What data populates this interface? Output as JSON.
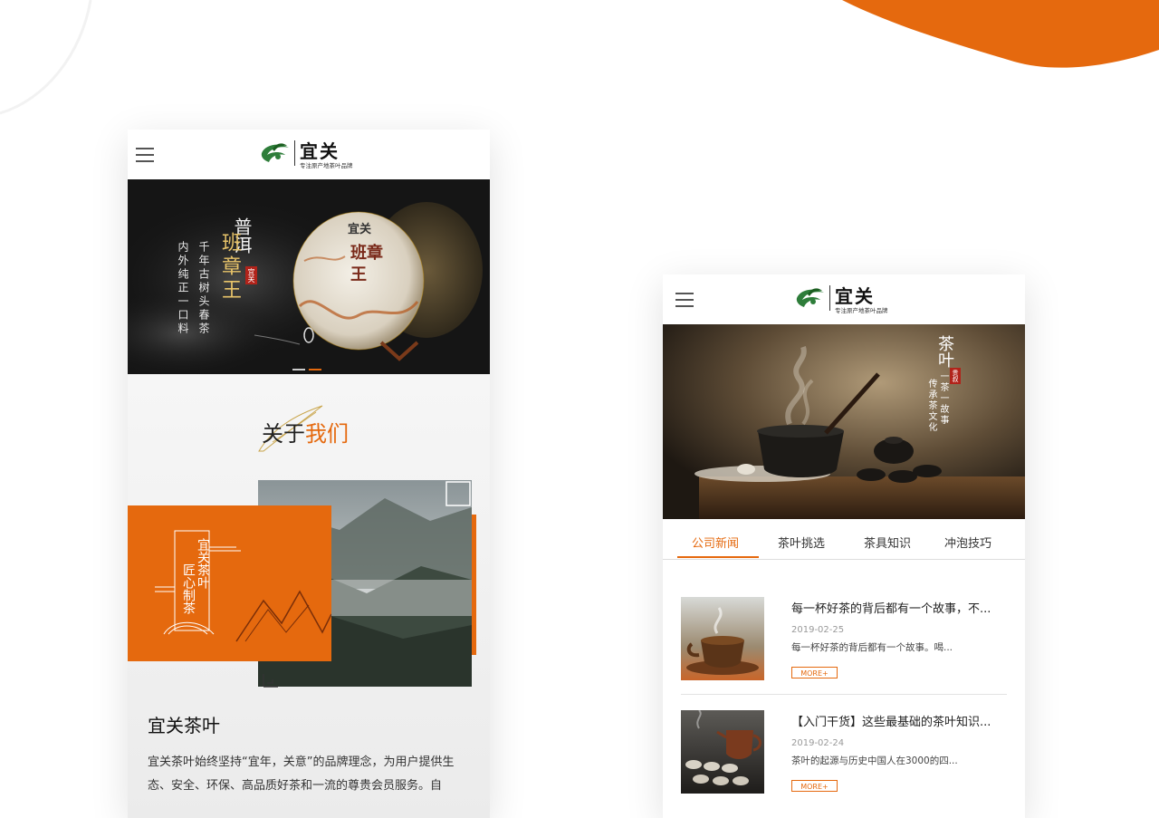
{
  "brand": {
    "name": "宜关",
    "tagline": "专注原产地茶叶品牌",
    "accent_color": "#e5690e"
  },
  "left_phone": {
    "banner": {
      "line_main_top": "普洱",
      "line_main": "班章王",
      "seal": "宜关",
      "line_a": "千年古树头春茶",
      "line_b": "内外纯正一口料",
      "cake_brand": "宜关",
      "cake_name": "班章王",
      "slides": 2,
      "active_slide": 2
    },
    "about": {
      "title_prefix": "关于",
      "title_highlight": "我们",
      "block_text_1": "宜关茶叶",
      "block_text_2": "匠心制茶",
      "company_name": "宜关茶叶",
      "description": "宜关茶叶始终坚持“宜年，关意”的品牌理念，为用户提供生态、安全、环保、高品质好茶和一流的尊贵会员服务。自"
    }
  },
  "right_phone": {
    "banner": {
      "title": "茶叶",
      "line_a": "一茶一故事",
      "line_b": "传承茶文化",
      "seal": "贵叔"
    },
    "tabs": [
      "公司新闻",
      "茶叶挑选",
      "茶具知识",
      "冲泡技巧"
    ],
    "active_tab": 0,
    "news": [
      {
        "title": "每一杯好茶的背后都有一个故事，不...",
        "date": "2019-02-25",
        "excerpt": "每一杯好茶的背后都有一个故事。喝...",
        "more": "MORE+"
      },
      {
        "title": "【入门干货】这些最基础的茶叶知识...",
        "date": "2019-02-24",
        "excerpt": "茶叶的起源与历史中国人在3000的四...",
        "more": "MORE+"
      }
    ]
  }
}
